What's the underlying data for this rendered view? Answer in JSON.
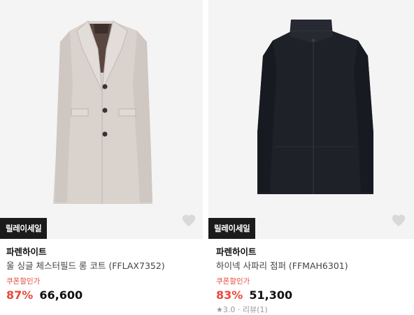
{
  "products": [
    {
      "badge": "릴레이세일",
      "brand": "파렌하이트",
      "name": "울 싱글 체스터필드 롱 코트 (FFLAX7352)",
      "coupon_label": "쿠폰할인가",
      "discount": "87%",
      "price": "66,600",
      "rating": "",
      "image_icon": "beige-coat-image",
      "heart_icon": "heart-icon",
      "colors": {
        "garment": "#d8d1cc",
        "lining": "#5a4640"
      }
    },
    {
      "badge": "릴레이세일",
      "brand": "파렌하이트",
      "name": "하이넥 사파리 점퍼 (FFMAH6301)",
      "coupon_label": "쿠폰할인가",
      "discount": "83%",
      "price": "51,300",
      "rating": "★3.0 · 리뷰(1)",
      "image_icon": "navy-jacket-image",
      "heart_icon": "heart-icon",
      "colors": {
        "garment": "#1f2129"
      }
    }
  ],
  "colors": {
    "accent": "#e8493a",
    "badge_bg": "#1b1b1b",
    "thumb_bg": "#f4f4f4"
  }
}
